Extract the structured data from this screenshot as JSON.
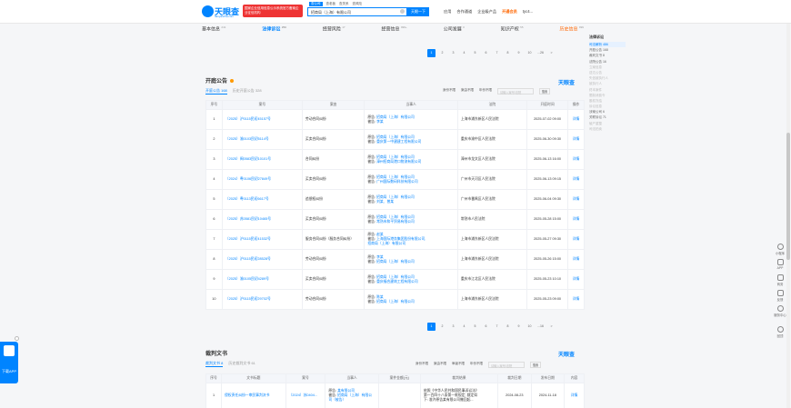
{
  "header": {
    "logo_text": "天眼查",
    "logo_sub": "tianyancha.com",
    "ad_text": "国家企业信用信息公示系统官方备案企业征信机构",
    "search_tabs": [
      "查公司",
      "查老板",
      "查关系",
      "查风险"
    ],
    "search_value": "招商局（上海）有限公司",
    "search_button": "天眼一下",
    "nav": [
      "应用",
      "合作通道",
      "企业级产品",
      "开通会员",
      "tyc4..."
    ]
  },
  "subnav": [
    {
      "label": "基本信息",
      "count": "241"
    },
    {
      "label": "法律诉讼",
      "count": "259"
    },
    {
      "label": "经营风险",
      "count": "17"
    },
    {
      "label": "经营信息",
      "count": "999+"
    },
    {
      "label": "公司发展",
      "count": "0"
    },
    {
      "label": "知识产权",
      "count": "55"
    },
    {
      "label": "历史信息",
      "count": "999"
    }
  ],
  "right_panel": {
    "title": "法律诉讼",
    "items": [
      {
        "label": "司法解析 486",
        "state": "active"
      },
      {
        "label": "开庭公告 168",
        "state": "normal"
      },
      {
        "label": "裁判文书 8",
        "state": "normal"
      },
      {
        "label": "法院公告 16",
        "state": "normal"
      },
      {
        "label": "立案信息",
        "state": "dim"
      },
      {
        "label": "送达公告",
        "state": "dim"
      },
      {
        "label": "失信被执行人",
        "state": "dim"
      },
      {
        "label": "被执行人",
        "state": "dim"
      },
      {
        "label": "终本案件",
        "state": "dim"
      },
      {
        "label": "限制消费令",
        "state": "dim"
      },
      {
        "label": "股权冻结",
        "state": "dim"
      },
      {
        "label": "诉讼信息",
        "state": "dim"
      },
      {
        "label": "涉案公司 6",
        "state": "normal"
      },
      {
        "label": "关联诉讼 71",
        "state": "normal"
      },
      {
        "label": "破产重整",
        "state": "dim"
      },
      {
        "label": "司法拍卖",
        "state": "dim"
      }
    ]
  },
  "top_pager": [
    "1",
    "2",
    "3",
    "4",
    "5",
    "6",
    "7",
    "8",
    "9",
    "10",
    "...26",
    ">"
  ],
  "hearings": {
    "title": "开庭公告",
    "tabs": [
      "开庭公告 168",
      "历史开庭公告 328"
    ],
    "filters": [
      "身份不限",
      "案由不限",
      "年份不限"
    ],
    "search_placeholder": "请输入案号/法院",
    "search_button": "搜索",
    "brand": "天眼查",
    "headers": [
      "序号",
      "案号",
      "案由",
      "当事人",
      "法院",
      "开庭时间",
      "操作"
    ],
    "rows": [
      {
        "no": "1",
        "case": "（2025）沪0115民初45157号",
        "reason": "劳动合同纠纷",
        "parties": [
          "原告: 招商局（上海）有限公司",
          "被告: 李某"
        ],
        "court": "上海市浦东新区人民法院",
        "time": "2025-07-02 09:00",
        "op": "详情"
      },
      {
        "no": "2",
        "case": "（2025）渝0103民初5114号",
        "reason": "买卖合同纠纷",
        "parties": [
          "原告: 招商局（上海）有限公司",
          "被告: 重庆第一中建建工程有限公司"
        ],
        "court": "重庆市渝中区人民法院",
        "time": "2025-06-30 09:30",
        "op": "详情"
      },
      {
        "no": "3",
        "case": "（2025）闽0583民初10101号",
        "reason": "合同纠纷",
        "parties": [
          "原告: 招商局（上海）有限公司",
          "被告: 漳州招商局港口物流有限公司"
        ],
        "court": "漳州市龙文区人民法院",
        "time": "2025-06-13 16:00",
        "op": "详情"
      },
      {
        "no": "4",
        "case": "（2024）粤0106民初27849号",
        "reason": "买卖合同纠纷",
        "parties": [
          "原告: 招商局（上海）有限公司",
          "被告: 广州国际数码科技有限公司"
        ],
        "court": "广州市天河区人民法院",
        "time": "2025-06-13 09:15",
        "op": "详情"
      },
      {
        "no": "5",
        "case": "（2025）粤0113民初6617号",
        "reason": "追偿权纠纷",
        "parties": [
          "原告: 招商局（上海）有限公司",
          "被告: 刘某、曾某"
        ],
        "court": "广州市番禺区人民法院",
        "time": "2025-06-04 09:30",
        "op": "详情"
      },
      {
        "no": "6",
        "case": "（2025）苏0581民初10465号",
        "reason": "买卖合同纠纷",
        "parties": [
          "原告: 招商局（上海）有限公司",
          "被告: 常熟市和平贸易有限公司"
        ],
        "court": "常熟市人民法院",
        "time": "2025-05-28 15:00",
        "op": "详情"
      },
      {
        "no": "7",
        "case": "（2025）沪0115民初41532号",
        "reason": "服务合同纠纷（服务合同纠纷）",
        "parties": [
          "原告: 赵某",
          "被告: 上海国际港务集团股份有限公司,",
          "招商局（上海）有限公司"
        ],
        "court": "上海市浦东新区人民法院",
        "time": "2025-05-27 09:30",
        "op": "详情"
      },
      {
        "no": "8",
        "case": "（2025）沪0115民初28528号",
        "reason": "劳动合同纠纷",
        "parties": [
          "原告: 李某",
          "被告: 招商局（上海）有限公司"
        ],
        "court": "上海市浦东新区人民法院",
        "time": "2025-05-26 15:00",
        "op": "详情"
      },
      {
        "no": "9",
        "case": "（2025）渝0105民初4289号",
        "reason": "买卖合同纠纷",
        "parties": [
          "原告: 招商局（上海）有限公司",
          "被告: 重庆福合建筑工程有限公司"
        ],
        "court": "重庆市江北区人民法院",
        "time": "2025-05-23 10:10",
        "op": "详情"
      },
      {
        "no": "10",
        "case": "（2025）沪0115民初29702号",
        "reason": "劳动合同纠纷",
        "parties": [
          "原告: 陈某",
          "被告: 招商局（上海）有限公司"
        ],
        "court": "上海市浦东新区人民法院",
        "time": "2025-05-23 09:00",
        "op": "详情"
      }
    ],
    "pager": [
      "1",
      "2",
      "3",
      "4",
      "5",
      "6",
      "7",
      "8",
      "9",
      "10",
      "...16",
      ">"
    ]
  },
  "judgments": {
    "title": "裁判文书",
    "tabs": [
      "裁判文书 8",
      "历史裁判文书 61"
    ],
    "filters": [
      "身份不限",
      "案由不限",
      "审级不限",
      "年份不限"
    ],
    "search_placeholder": "请输入案号/法院",
    "search_button": "搜索",
    "brand": "天眼查",
    "headers": [
      "序号",
      "文书标题",
      "案号",
      "当事人",
      "案件金额(元)",
      "裁判结果",
      "裁判日期",
      "发布日期",
      "内容"
    ],
    "row": {
      "no": "1",
      "title": "侵权责任纠纷一审民事判决书",
      "case": "（2024）苏0404...",
      "parties": [
        "原告: 某有限公司",
        "被告: 招商局（上海）有限公司（被告）"
      ],
      "amount": "",
      "result": [
        "依照《中华人民共和国民事诉讼法》",
        "第一百四十八条第一款规定, 裁定如",
        "下: 准许原告某有限公司撤回起..."
      ],
      "judge_date": "2024-08-23",
      "publish_date": "2024-11-18",
      "op": "详情"
    }
  },
  "float_app": {
    "label": "下载APP"
  },
  "right_tools": [
    "小程序",
    "APP",
    "商务",
    "反馈",
    "服务中心",
    "回顶"
  ]
}
